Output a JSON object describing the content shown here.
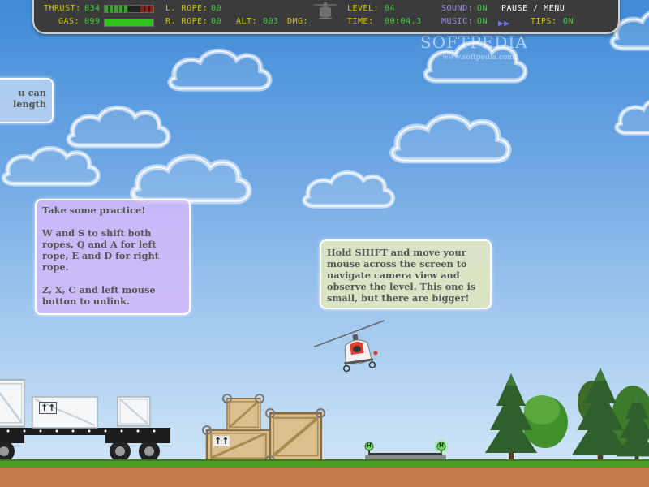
{
  "hud": {
    "thrust_label": "THRUST:",
    "thrust_value": "034",
    "thrust_level": 0.34,
    "gas_label": "GAS:",
    "gas_value": "099",
    "gas_level": 0.99,
    "l_rope_label": "L. ROPE:",
    "l_rope_value": "00",
    "r_rope_label": "R. ROPE:",
    "r_rope_value": "00",
    "alt_label": "ALT:",
    "alt_value": "003",
    "dmg_label": "DMG:",
    "level_label": "LEVEL:",
    "level_value": "04",
    "time_label": "TIME:",
    "time_value": "00:04.3",
    "sound_label": "SOUND:",
    "sound_value": "ON",
    "music_label": "MUSIC:",
    "music_value": "ON",
    "tips_label": "TIPS:",
    "tips_value": "ON",
    "pause_menu": "PAUSE / MENU",
    "fast_forward_icon": "fast-forward-icon",
    "colors": {
      "label": "#d2c400",
      "value": "#42d040",
      "panel": "#3b3b3b",
      "thrust_bar": "#3aa52a",
      "gas_bar": "#2ec41a"
    }
  },
  "watermark": {
    "brand": "SOFTPEDIA",
    "url": "www.softpedia.com"
  },
  "hints": {
    "left_partial": [
      "u can",
      "length"
    ],
    "practice": {
      "title": "Take some practice!",
      "ropes": "W and S to shift both ropes, Q and A for left rope, E and D for right rope.",
      "unlink": "Z, X, C and left mouse button to unlink."
    },
    "camera": "Hold SHIFT and move your mouse across the screen to navigate camera view and observe the level. This one is small, but there are bigger!"
  },
  "crate_marks": {
    "up_arrows": "↑↑"
  },
  "landing_pad": {
    "marker": "H"
  }
}
